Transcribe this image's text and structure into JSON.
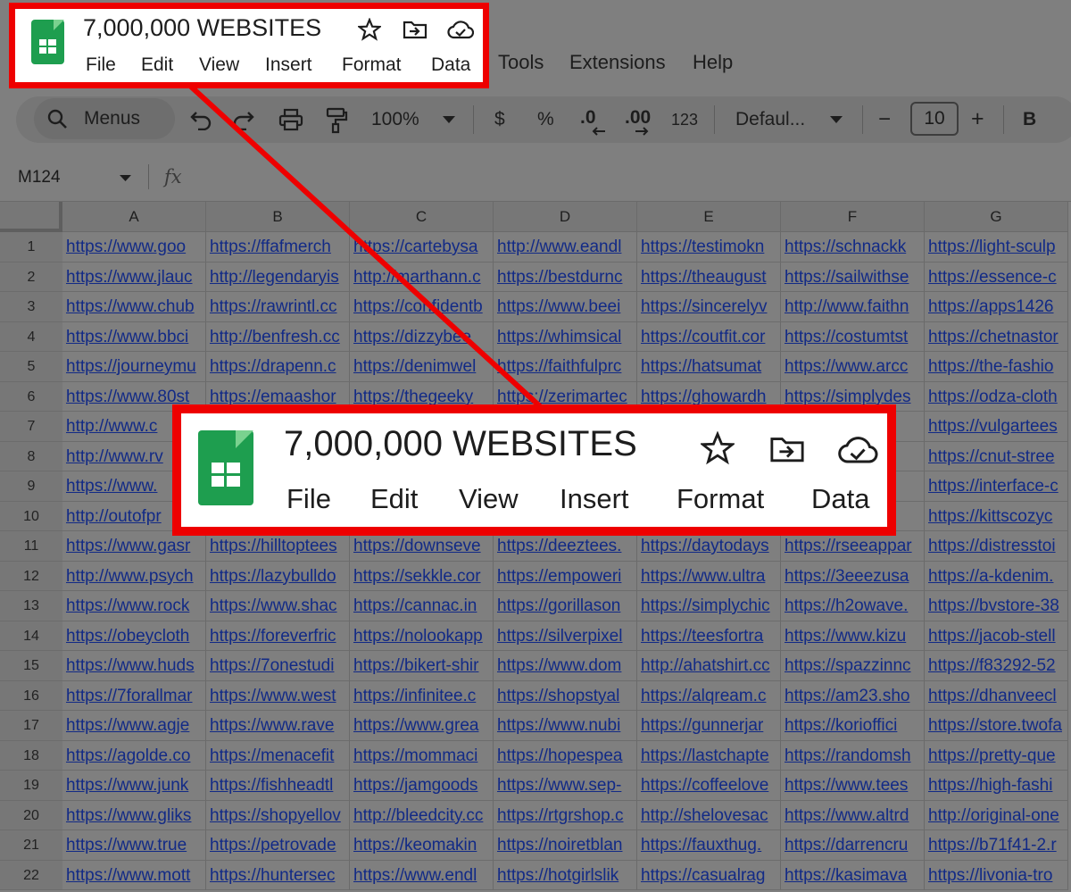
{
  "doc_title": "7,000,000 WEBSITES",
  "menu": [
    "File",
    "Edit",
    "View",
    "Insert",
    "Format",
    "Data",
    "Tools",
    "Extensions",
    "Help"
  ],
  "toolbar": {
    "search_label": "Menus",
    "zoom": "100%",
    "currency": "$",
    "percent": "%",
    "dec_decrease": ".0",
    "dec_increase": ".00",
    "number_format": "123",
    "font": "Defaul...",
    "minus": "−",
    "font_size": "10",
    "plus": "+",
    "bold": "B"
  },
  "formula_bar": {
    "cell_ref": "M124",
    "fx": "fx"
  },
  "columns": [
    "A",
    "B",
    "C",
    "D",
    "E",
    "F",
    "G"
  ],
  "rows": [
    [
      "https://www.goo",
      "https://ffafmerch",
      "https://cartebysa",
      "http://www.eandl",
      "https://testimokn",
      "https://schnackk",
      "https://light-sculp"
    ],
    [
      "https://www.jlauc",
      "http://legendaryis",
      "http://marthann.c",
      "https://bestdurnc",
      "https://theaugust",
      "https://sailwithse",
      "https://essence-c"
    ],
    [
      "https://www.chub",
      "https://rawrintl.cc",
      "https://confidentb",
      "https://www.beei",
      "https://sincerelyv",
      "http://www.faithn",
      "https://apps1426"
    ],
    [
      "https://www.bbci",
      "http://benfresh.cc",
      "https://dizzybee",
      "https://whimsical",
      "https://coutfit.cor",
      "https://costumtst",
      "https://chetnastor"
    ],
    [
      "https://journeymu",
      "https://drapenn.c",
      "https://denimwel",
      "https://faithfulprc",
      "https://hatsumat",
      "https://www.arcc",
      "https://the-fashio"
    ],
    [
      "https://www.80st",
      "https://emaashor",
      "https://thegeeky",
      "https://zerimartec",
      "https://ghowardh",
      "https://simplydes",
      "https://odza-cloth"
    ],
    [
      "http://www.c",
      "",
      "",
      "",
      "",
      "sou",
      "https://vulgartees"
    ],
    [
      "http://www.rv",
      "",
      "",
      "",
      "",
      "othi",
      "https://cnut-stree"
    ],
    [
      "https://www.",
      "",
      "",
      "",
      "",
      "ats",
      "https://interface-c"
    ],
    [
      "http://outofpr",
      "",
      "",
      "",
      "",
      "yle.",
      "https://kittscozyc"
    ],
    [
      "https://www.gasr",
      "https://hilltoptees",
      "https://downseve",
      "https://deeztees.",
      "https://daytodays",
      "https://rseeappar",
      "https://distresstoi"
    ],
    [
      "http://www.psych",
      "https://lazybulldo",
      "https://sekkle.cor",
      "https://empoweri",
      "https://www.ultra",
      "https://3eeezusa",
      "https://a-kdenim."
    ],
    [
      "https://www.rock",
      "https://www.shac",
      "https://cannac.in",
      "https://gorillason",
      "https://simplychic",
      "https://h2owave.",
      "https://bvstore-38"
    ],
    [
      "https://obeycloth",
      "https://foreverfric",
      "https://nolookapp",
      "https://silverpixel",
      "https://teesfortra",
      "https://www.kizu",
      "https://jacob-stell"
    ],
    [
      "https://www.huds",
      "https://7onestudi",
      "https://bikert-shir",
      "https://www.dom",
      "http://ahatshirt.cc",
      "https://spazzinnc",
      "https://f83292-52"
    ],
    [
      "https://7forallmar",
      "https://www.west",
      "https://infinitee.c",
      "https://shopstyal",
      "https://alqream.c",
      "https://am23.sho",
      "https://dhanveecl"
    ],
    [
      "https://www.agje",
      "https://www.rave",
      "https://www.grea",
      "https://www.nubi",
      "https://gunnerjar",
      "https://korioffici",
      "https://store.twofa"
    ],
    [
      "https://agolde.co",
      "https://menacefit",
      "https://mommaci",
      "https://hopespea",
      "https://lastchapte",
      "https://randomsh",
      "https://pretty-que"
    ],
    [
      "https://www.junk",
      "https://fishheadtl",
      "https://jamgoods",
      "https://www.sep-",
      "https://coffeelove",
      "https://www.tees",
      "https://high-fashi"
    ],
    [
      "https://www.gliks",
      "https://shopyellov",
      "http://bleedcity.cc",
      "https://rtgrshop.c",
      "http://shelovesac",
      "https://www.altrd",
      "http://original-one"
    ],
    [
      "https://www.true",
      "https://petrovade",
      "https://keomakin",
      "https://noiretblan",
      "https://fauxthug.",
      "https://darrencru",
      "https://b71f41-2.r"
    ],
    [
      "https://www.mott",
      "https://huntersec",
      "https://www.endl",
      "https://hotgirlslik",
      "https://casualrag",
      "https://kasimava",
      "https://livonia-tro"
    ]
  ],
  "row_numbers": [
    "1",
    "2",
    "3",
    "4",
    "5",
    "6",
    "7",
    "8",
    "9",
    "10",
    "11",
    "12",
    "13",
    "14",
    "15",
    "16",
    "17",
    "18",
    "19",
    "20",
    "21",
    "22"
  ],
  "callout_menu": [
    "File",
    "Edit",
    "View",
    "Insert",
    "Format",
    "Data"
  ],
  "colors": {
    "highlight": "#ee0000",
    "sheets_green": "#1e9e4f",
    "link": "#122a86"
  }
}
